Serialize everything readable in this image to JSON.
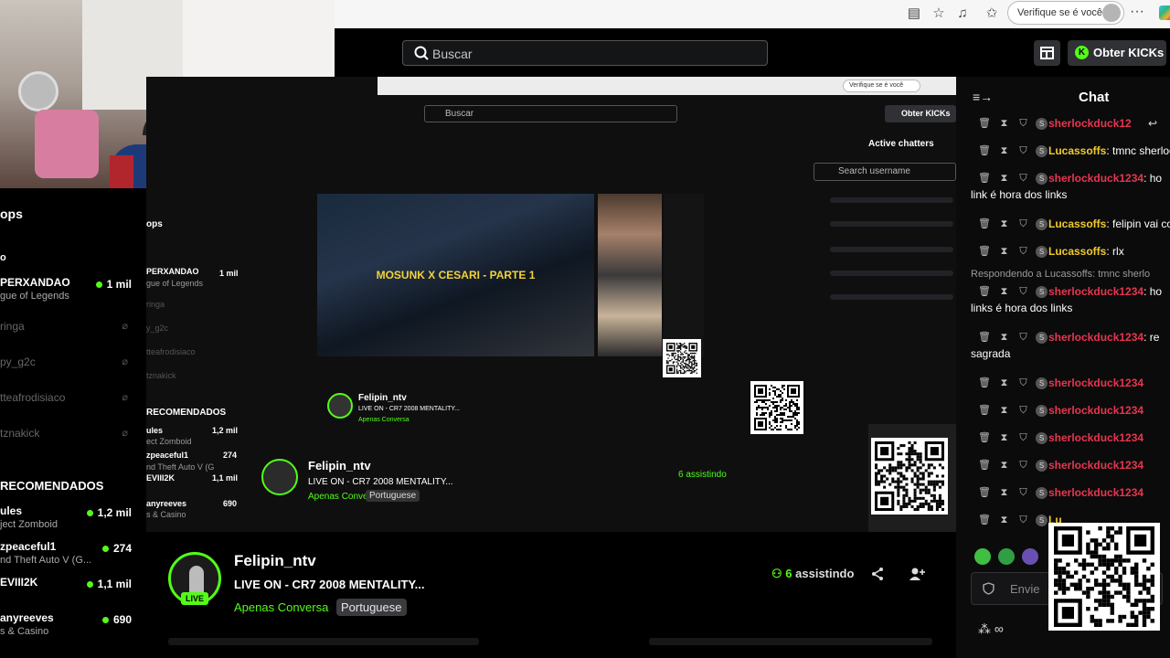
{
  "browser": {
    "verify_label": "Verifique se é você",
    "more_label": "···"
  },
  "topbar": {
    "search_placeholder": "Buscar",
    "kicks_label": "Obter KICKs"
  },
  "sidebar": {
    "top_title": "ops",
    "top_partial": "o",
    "live": [
      {
        "name": "PERXANDAO",
        "game": "gue of Legends",
        "viewers": "1 mil"
      }
    ],
    "offline": [
      "ringa",
      "py_g2c",
      "tteafrodisiaco",
      "tznakick"
    ],
    "recommended_title": "RECOMENDADOS",
    "recommended": [
      {
        "name": "ules",
        "game": "ject Zomboid",
        "viewers": "1,2 mil"
      },
      {
        "name": "zpeaceful1",
        "game": "nd Theft Auto V (G...",
        "viewers": "274"
      },
      {
        "name": "EVIII2K",
        "game": "",
        "viewers": "1,1 mil"
      },
      {
        "name": "anyreeves",
        "game": "s & Casino",
        "viewers": "690"
      }
    ]
  },
  "nested": {
    "verify_label": "Verifique se é você",
    "search_placeholder": "Buscar",
    "kicks_label": "Obter KICKs",
    "active_chatters_title": "Active chatters",
    "search_username_placeholder": "Search username",
    "video_title": "MOSUNK X CESARI - PARTE 1",
    "inner_channel": {
      "name": "Felipin_ntv",
      "title": "LIVE ON - CR7 2008 MENTALITY...",
      "category": "Apenas Conversa",
      "language": "Portuguese"
    },
    "channel2": {
      "name": "Felipin_ntv",
      "title": "LIVE ON - CR7 2008 MENTALITY...",
      "category": "Apenas Conversa",
      "language": "Portuguese",
      "watching": "6 assistindo"
    },
    "side_title": "ops",
    "side_recommended": "RECOMENDADOS",
    "side_rows": [
      "PERXANDAO",
      "gue of Legends",
      "ringa",
      "y_g2c",
      "tteafrodisiaco",
      "tznakick"
    ],
    "side_recs": [
      "ules",
      "ect Zomboid",
      "zpeaceful1",
      "nd Theft Auto V (G",
      "EVIII2K",
      "anyreeves",
      "s & Casino"
    ],
    "side_values": [
      "1 mil",
      "1,2 mil",
      "274",
      "1,1 mil",
      "690"
    ]
  },
  "channel": {
    "name": "Felipin_ntv",
    "live_label": "LIVE",
    "title": "LIVE ON - CR7 2008 MENTALITY...",
    "category": "Apenas Conversa",
    "language": "Portuguese",
    "watching_count": "6",
    "watching_label": "assistindo"
  },
  "chat": {
    "title": "Chat",
    "messages": [
      {
        "user": "sherlockduck12",
        "text": "",
        "color": "red"
      },
      {
        "user": "Lucassoffs",
        "text": "tmnc sherlock",
        "color": "yellow"
      },
      {
        "user": "sherlockduck1234",
        "text": "ho",
        "color": "red",
        "cont": "link é hora dos links"
      },
      {
        "user": "Lucassoffs",
        "text": "felipin vai cor",
        "color": "yellow"
      },
      {
        "user": "Lucassoffs",
        "text": "rlx",
        "color": "yellow"
      },
      {
        "user": "sherlockduck1234",
        "text": "ho",
        "color": "red",
        "cont": "links é hora dos links"
      },
      {
        "user": "sherlockduck1234",
        "text": "re",
        "color": "red",
        "cont": "sagrada"
      },
      {
        "user": "sherlockduck1234",
        "text": "",
        "color": "red"
      },
      {
        "user": "sherlockduck1234",
        "text": "",
        "color": "red"
      },
      {
        "user": "sherlockduck1234",
        "text": "",
        "color": "red"
      },
      {
        "user": "sherlockduck1234",
        "text": "",
        "color": "red"
      },
      {
        "user": "sherlockduck1234",
        "text": "",
        "color": "red"
      },
      {
        "user": "Lu",
        "text": "",
        "color": "yellow"
      }
    ],
    "reply_label": "Respondendo a Lucassoffs: tmnc sherlo",
    "input_placeholder": "Envie",
    "footer_label": "∞"
  },
  "colors": {
    "accent": "#53fc18",
    "username_red": "#e8364d",
    "username_yellow": "#f0cb2c",
    "panel": "#0b0b0c"
  }
}
